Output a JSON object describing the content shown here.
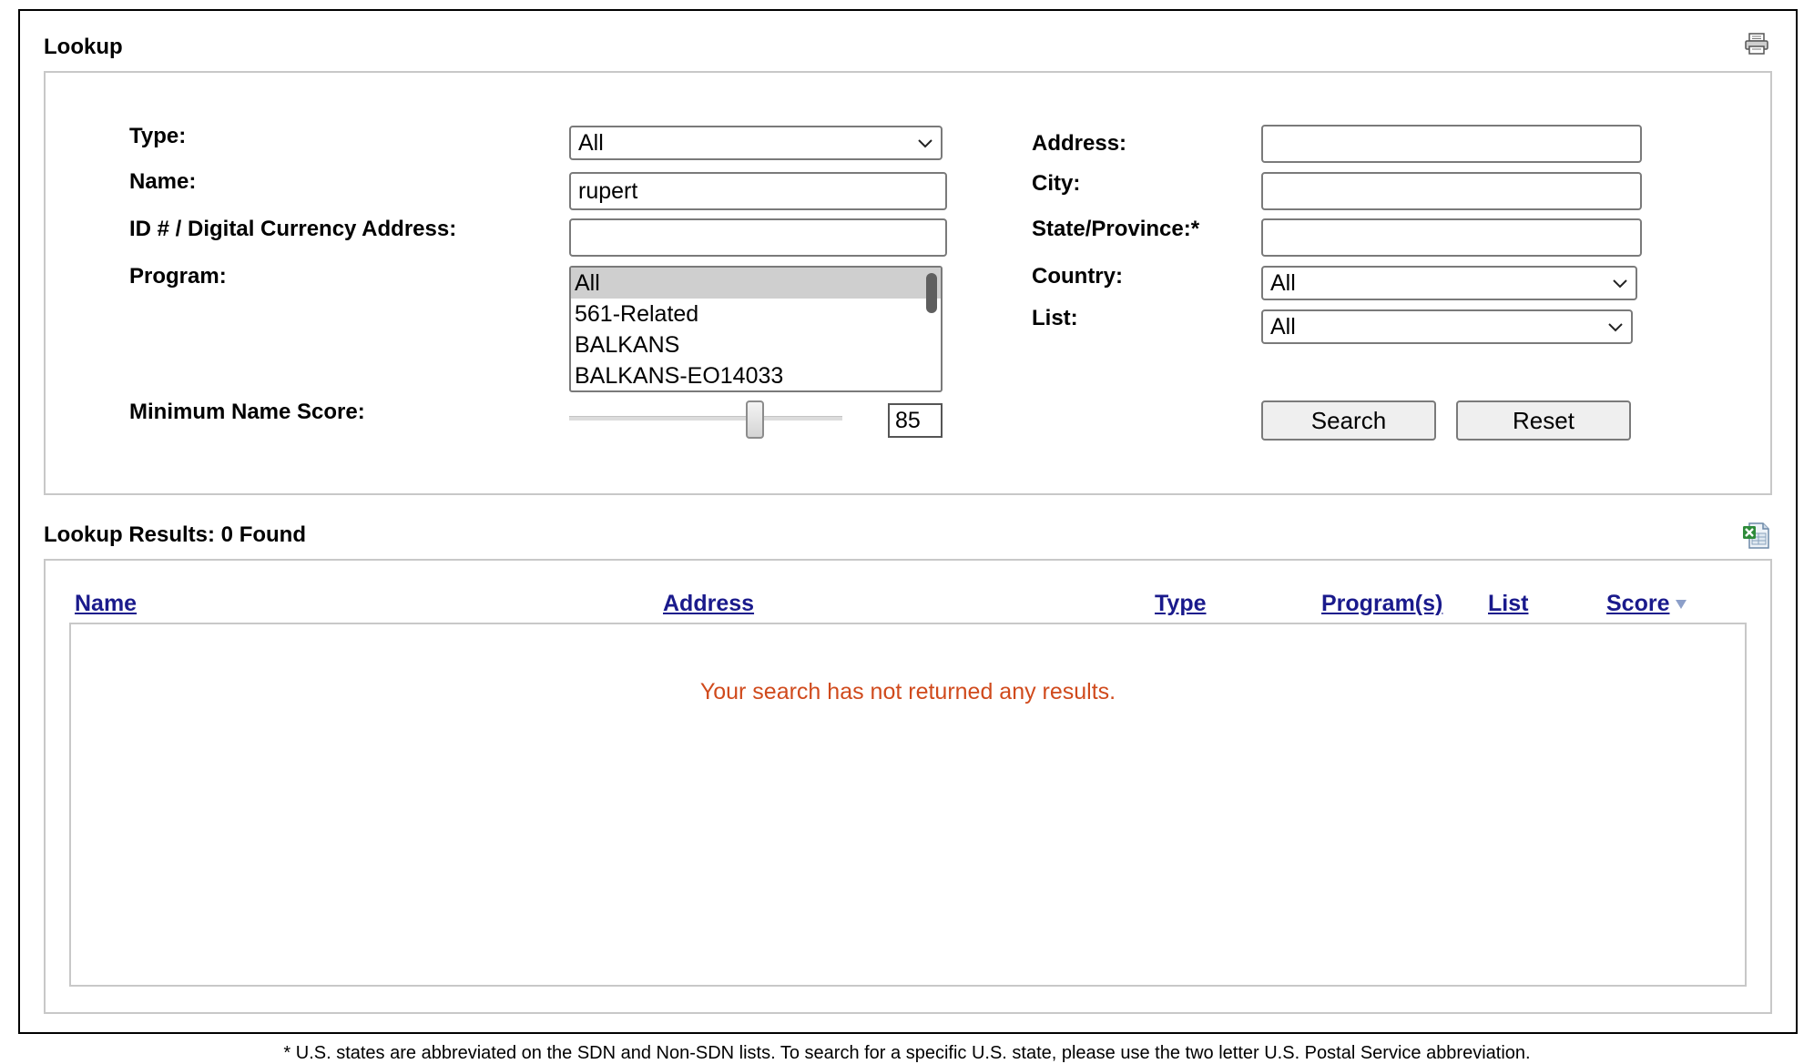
{
  "lookup": {
    "title": "Lookup",
    "fields": {
      "type": {
        "label": "Type:",
        "value": "All"
      },
      "name": {
        "label": "Name:",
        "value": "rupert"
      },
      "id": {
        "label": "ID # / Digital Currency Address:",
        "value": ""
      },
      "program": {
        "label": "Program:",
        "options": [
          "All",
          "561-Related",
          "BALKANS",
          "BALKANS-EO14033"
        ],
        "selected": "All"
      },
      "min_score": {
        "label": "Minimum Name Score:",
        "value": "85",
        "slider_fraction": 0.68
      },
      "address": {
        "label": "Address:",
        "value": ""
      },
      "city": {
        "label": "City:",
        "value": ""
      },
      "state": {
        "label": "State/Province:*",
        "value": ""
      },
      "country": {
        "label": "Country:",
        "value": "All"
      },
      "list": {
        "label": "List:",
        "value": "All"
      }
    },
    "buttons": {
      "search": "Search",
      "reset": "Reset"
    }
  },
  "results": {
    "title": "Lookup Results: 0 Found",
    "columns": [
      "Name",
      "Address",
      "Type",
      "Program(s)",
      "List",
      "Score"
    ],
    "sort_column": "Score",
    "empty_message": "Your search has not returned any results."
  },
  "footnote": "* U.S. states are abbreviated on the SDN and Non-SDN lists. To search for a specific U.S. state, please use the two letter U.S. Postal Service abbreviation.",
  "icons": {
    "print": "printer-icon",
    "export": "excel-export-icon"
  },
  "colors": {
    "link": "#1a1a8c",
    "empty_message": "#d04a1c",
    "border": "#c8c8c8"
  }
}
